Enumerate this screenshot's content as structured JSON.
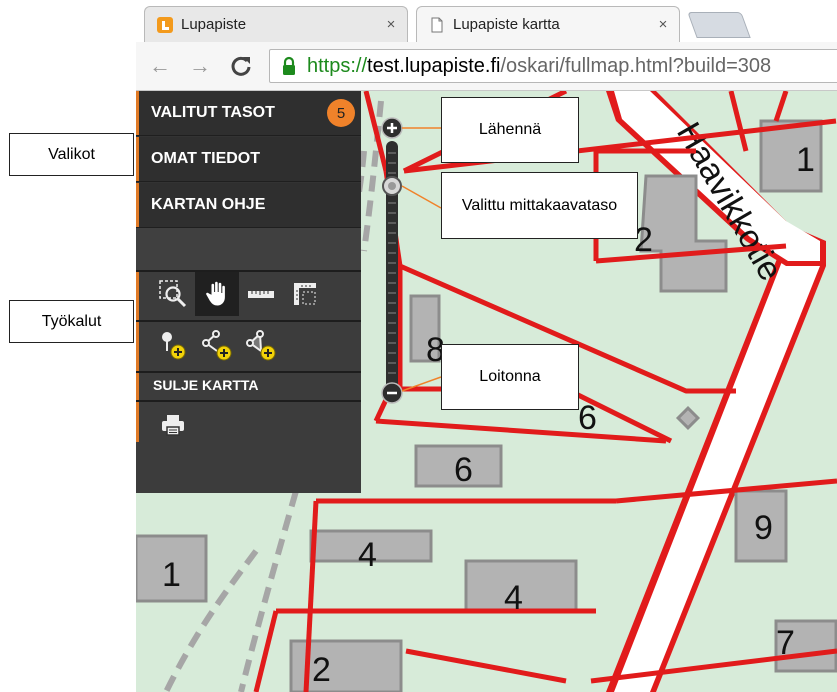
{
  "annotations": {
    "valikot": "Valikot",
    "tyokalut": "Työkalut",
    "lahenna": "Lähennä",
    "valittu": "Valittu mittakaavataso",
    "loitonna": "Loitonna"
  },
  "browser": {
    "tabs": [
      {
        "title": "Lupapiste",
        "icon": "lupapiste-favicon",
        "active": false
      },
      {
        "title": "Lupapiste kartta",
        "icon": "page-icon",
        "active": true
      }
    ],
    "close_glyph": "×",
    "nav": {
      "back": "←",
      "forward": "→",
      "reload": "C"
    },
    "url": {
      "scheme": "https://",
      "host": "test.lupapiste.fi",
      "path": "/oskari/fullmap.html?build=308"
    }
  },
  "menu": {
    "items": [
      {
        "label": "VALITUT TASOT",
        "badge": "5"
      },
      {
        "label": "OMAT TIEDOT"
      },
      {
        "label": "KARTAN OHJE"
      }
    ]
  },
  "tools": {
    "row1": [
      "zoom-box-icon",
      "pan-hand-icon",
      "measure-line-icon",
      "measure-area-icon"
    ],
    "row2": [
      "add-point-icon",
      "add-line-icon",
      "add-area-icon"
    ],
    "close_map": "SULJE KARTTA",
    "print": "printer-icon"
  },
  "map": {
    "street_name": "Haavikkotie",
    "house_numbers": [
      "1",
      "2",
      "8",
      "6",
      "6",
      "9",
      "4",
      "4",
      "1",
      "7",
      "2"
    ]
  },
  "colors": {
    "parcel_line": "#e11b1b",
    "panel_bg": "#333333",
    "accent": "#e07a26",
    "map_bg": "#d7ebd9",
    "building": "#b3b3b3"
  }
}
